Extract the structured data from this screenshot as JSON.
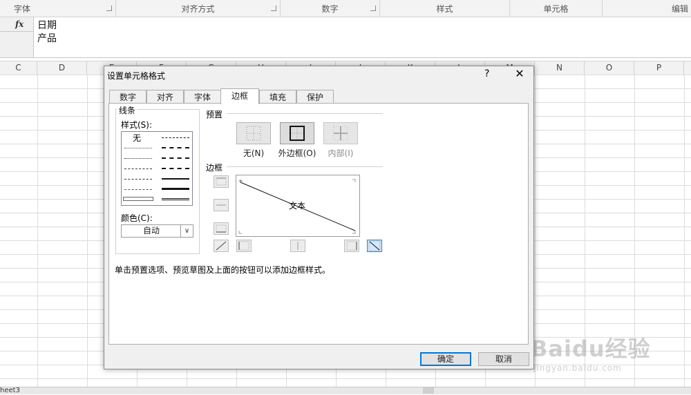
{
  "ribbon": {
    "groups": [
      "字体",
      "对齐方式",
      "数字",
      "样式",
      "单元格",
      "编辑"
    ]
  },
  "formula_bar": {
    "fx_label": "fx",
    "lines": [
      "日期",
      "产品"
    ]
  },
  "columns": [
    "C",
    "D",
    "E",
    "F",
    "G",
    "H",
    "I",
    "J",
    "K",
    "L",
    "M",
    "N",
    "O",
    "P"
  ],
  "sheet_tab": "heet3",
  "dialog": {
    "title": "设置单元格格式",
    "help_label": "?",
    "close_label": "✕",
    "tabs": [
      {
        "label": "数字",
        "active": false
      },
      {
        "label": "对齐",
        "active": false
      },
      {
        "label": "字体",
        "active": false
      },
      {
        "label": "边框",
        "active": true
      },
      {
        "label": "填充",
        "active": false
      },
      {
        "label": "保护",
        "active": false
      }
    ],
    "line_group": {
      "legend": "线条",
      "style_label": "样式(S):",
      "none_label": "无",
      "color_label": "颜色(C):",
      "color_value": "自动"
    },
    "preset_group": {
      "legend": "预置",
      "presets": [
        {
          "label": "无(N)",
          "disabled": false
        },
        {
          "label": "外边框(O)",
          "disabled": false
        },
        {
          "label": "内部(I)",
          "disabled": true
        }
      ]
    },
    "border_group": {
      "legend": "边框",
      "preview_text": "文本"
    },
    "hint": "单击预置选项、预览草图及上面的按钮可以添加边框样式。",
    "ok_label": "确定",
    "cancel_label": "取消"
  },
  "watermark": {
    "main": "Baidu经验",
    "sub": "jingyan.baidu.com"
  }
}
